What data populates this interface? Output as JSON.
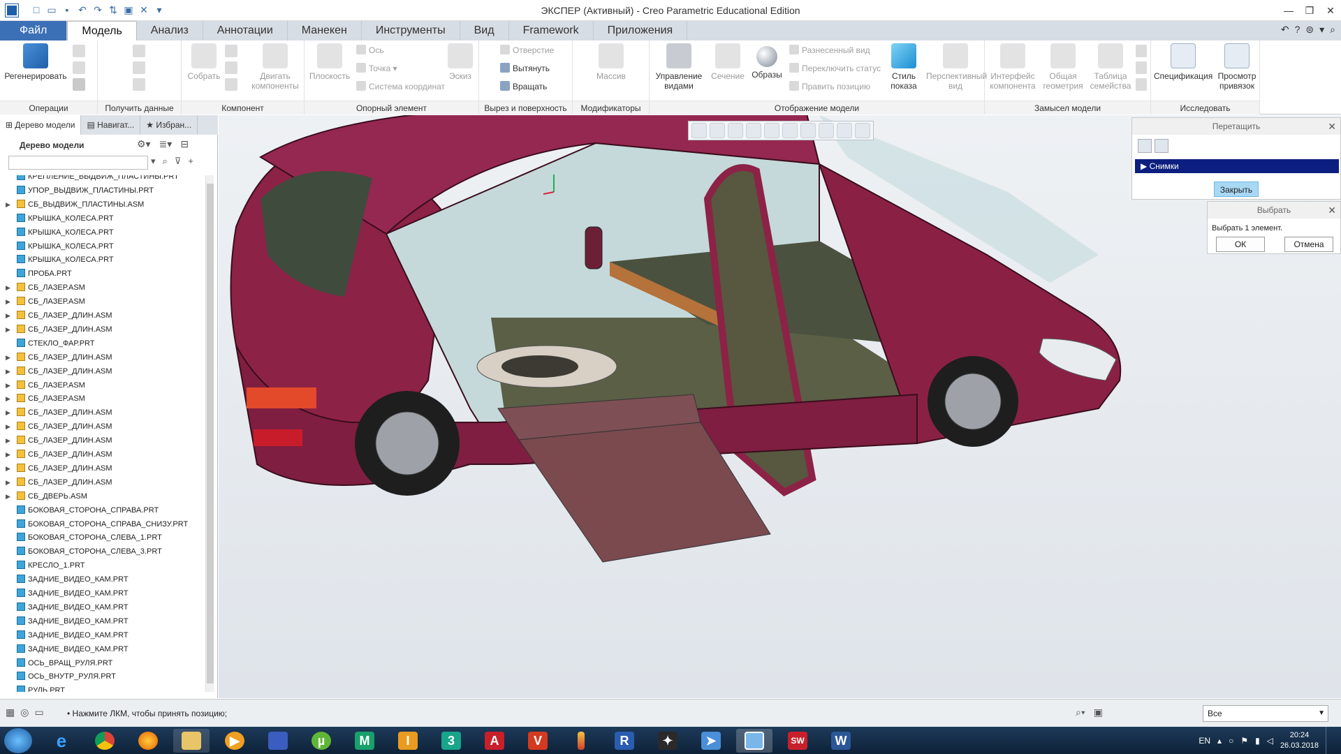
{
  "window": {
    "title": "ЭКСПЕР (Активный) - Creo Parametric Educational Edition"
  },
  "colors": {
    "file_tab": "#3b6fb6",
    "selection_row": "#0c1f80",
    "close_button": "#a8d8f4",
    "car_body": "#8c2246",
    "floor": "#5a5f46"
  },
  "tabs": [
    {
      "label": "Файл"
    },
    {
      "label": "Модель"
    },
    {
      "label": "Анализ"
    },
    {
      "label": "Аннотации"
    },
    {
      "label": "Манекен"
    },
    {
      "label": "Инструменты"
    },
    {
      "label": "Вид"
    },
    {
      "label": "Framework"
    },
    {
      "label": "Приложения"
    }
  ],
  "ribbon": {
    "groups": {
      "operations": "Операции",
      "get_data": "Получить данные",
      "component": "Компонент",
      "datum": "Опорный элемент",
      "cut_surface": "Вырез и поверхность",
      "modifiers": "Модификаторы",
      "model_display": "Отображение модели",
      "design_intent": "Замысел модели",
      "investigate": "Исследовать"
    },
    "buttons": {
      "regenerate": "Регенерировать",
      "assemble": "Собрать",
      "drag_components_1": "Двигать",
      "drag_components_2": "компоненты",
      "plane": "Плоскость",
      "axis": "Ось",
      "point": "Точка",
      "csys": "Система координат",
      "sketch": "Эскиз",
      "hole": "Отверстие",
      "extrude": "Вытянуть",
      "revolve": "Вращать",
      "pattern": "Массив",
      "manage_views_1": "Управление",
      "manage_views_2": "видами",
      "section": "Сечение",
      "appearances": "Образы",
      "exploded_view": "Разнесенный вид",
      "toggle_status": "Переключить статус",
      "edit_position": "Править позицию",
      "display_style_1": "Стиль",
      "display_style_2": "показа",
      "perspective_1": "Перспективный",
      "perspective_2": "вид",
      "component_interface_1": "Интерфейс",
      "component_interface_2": "компонента",
      "publish_geometry_1": "Общая",
      "publish_geometry_2": "геометрия",
      "family_table_1": "Таблица",
      "family_table_2": "семейства",
      "bom": "Спецификация",
      "view_references_1": "Просмотр",
      "view_references_2": "привязок"
    }
  },
  "left_panel": {
    "tabs": [
      "Дерево модели",
      "Навигат...",
      "Избран..."
    ],
    "tree_title": "Дерево модели",
    "items": [
      {
        "label": "КРЕПЛЕНИЕ_ВЫДВИЖ_ПЛАСТИНЫ.PRT",
        "type": "prt"
      },
      {
        "label": "УПОР_ВЫДВИЖ_ПЛАСТИНЫ.PRT",
        "type": "prt"
      },
      {
        "label": "СБ_ВЫДВИЖ_ПЛАСТИНЫ.ASM",
        "type": "asm"
      },
      {
        "label": "КРЫШКА_КОЛЕСА.PRT",
        "type": "prt"
      },
      {
        "label": "КРЫШКА_КОЛЕСА.PRT",
        "type": "prt"
      },
      {
        "label": "КРЫШКА_КОЛЕСА.PRT",
        "type": "prt"
      },
      {
        "label": "КРЫШКА_КОЛЕСА.PRT",
        "type": "prt"
      },
      {
        "label": "ПРОБА.PRT",
        "type": "prt"
      },
      {
        "label": "СБ_ЛАЗЕР.ASM",
        "type": "asm"
      },
      {
        "label": "СБ_ЛАЗЕР.ASM",
        "type": "asm"
      },
      {
        "label": "СБ_ЛАЗЕР_ДЛИН.ASM",
        "type": "asm"
      },
      {
        "label": "СБ_ЛАЗЕР_ДЛИН.ASM",
        "type": "asm"
      },
      {
        "label": "СТЕКЛО_ФАР.PRT",
        "type": "prt"
      },
      {
        "label": "СБ_ЛАЗЕР_ДЛИН.ASM",
        "type": "asm"
      },
      {
        "label": "СБ_ЛАЗЕР_ДЛИН.ASM",
        "type": "asm"
      },
      {
        "label": "СБ_ЛАЗЕР.ASM",
        "type": "asm"
      },
      {
        "label": "СБ_ЛАЗЕР.ASM",
        "type": "asm"
      },
      {
        "label": "СБ_ЛАЗЕР_ДЛИН.ASM",
        "type": "asm"
      },
      {
        "label": "СБ_ЛАЗЕР_ДЛИН.ASM",
        "type": "asm"
      },
      {
        "label": "СБ_ЛАЗЕР_ДЛИН.ASM",
        "type": "asm"
      },
      {
        "label": "СБ_ЛАЗЕР_ДЛИН.ASM",
        "type": "asm"
      },
      {
        "label": "СБ_ЛАЗЕР_ДЛИН.ASM",
        "type": "asm"
      },
      {
        "label": "СБ_ЛАЗЕР_ДЛИН.ASM",
        "type": "asm"
      },
      {
        "label": "СБ_ДВЕРЬ.ASM",
        "type": "asm"
      },
      {
        "label": "БОКОВАЯ_СТОРОНА_СПРАВА.PRT",
        "type": "prt"
      },
      {
        "label": "БОКОВАЯ_СТОРОНА_СПРАВА_СНИЗУ.PRT",
        "type": "prt"
      },
      {
        "label": "БОКОВАЯ_СТОРОНА_СЛЕВА_1.PRT",
        "type": "prt"
      },
      {
        "label": "БОКОВАЯ_СТОРОНА_СЛЕВА_3.PRT",
        "type": "prt"
      },
      {
        "label": "КРЕСЛО_1.PRT",
        "type": "prt"
      },
      {
        "label": "ЗАДНИЕ_ВИДЕО_КАМ.PRT",
        "type": "prt"
      },
      {
        "label": "ЗАДНИЕ_ВИДЕО_КАМ.PRT",
        "type": "prt"
      },
      {
        "label": "ЗАДНИЕ_ВИДЕО_КАМ.PRT",
        "type": "prt"
      },
      {
        "label": "ЗАДНИЕ_ВИДЕО_КАМ.PRT",
        "type": "prt"
      },
      {
        "label": "ЗАДНИЕ_ВИДЕО_КАМ.PRT",
        "type": "prt"
      },
      {
        "label": "ЗАДНИЕ_ВИДЕО_КАМ.PRT",
        "type": "prt"
      },
      {
        "label": "ОСЬ_ВРАЩ_РУЛЯ.PRT",
        "type": "prt"
      },
      {
        "label": "ОСЬ_ВНУТР_РУЛЯ.PRT",
        "type": "prt"
      },
      {
        "label": "РУЛЬ.PRT",
        "type": "prt"
      }
    ]
  },
  "drag_dialog": {
    "title": "Перетащить",
    "snapshots_label": "Снимки",
    "close_label": "Закрыть"
  },
  "select_dialog": {
    "title": "Выбрать",
    "message": "Выбрать 1 элемент.",
    "ok": "ОК",
    "cancel": "Отмена"
  },
  "status": {
    "message": "• Нажмите ЛКМ, чтобы принять позицию;",
    "filter_value": "Все"
  },
  "taskbar": {
    "language": "EN",
    "time": "20:24",
    "date": "26.03.2018"
  }
}
